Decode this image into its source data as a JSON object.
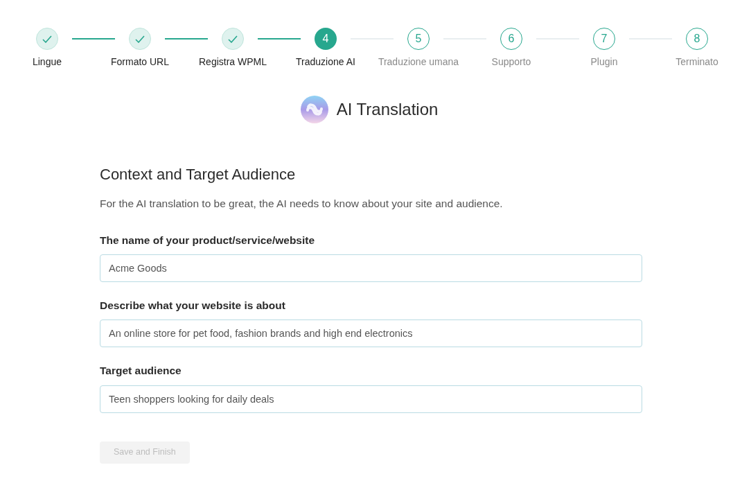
{
  "steps": [
    {
      "label": "Lingue",
      "completed": true,
      "selected": false
    },
    {
      "label": "Formato URL",
      "completed": true,
      "selected": false
    },
    {
      "label": "Registra WPML",
      "completed": true,
      "selected": false
    },
    {
      "number": "4",
      "label": "Traduzione AI",
      "completed": false,
      "selected": true
    },
    {
      "number": "5",
      "label": "Traduzione umana",
      "completed": false,
      "selected": false
    },
    {
      "number": "6",
      "label": "Supporto",
      "completed": false,
      "selected": false
    },
    {
      "number": "7",
      "label": "Plugin",
      "completed": false,
      "selected": false
    },
    {
      "number": "8",
      "label": "Terminato",
      "completed": false,
      "selected": false
    }
  ],
  "header": {
    "title": "AI Translation"
  },
  "section": {
    "title": "Context and Target Audience",
    "description": "For the AI translation to be great, the AI needs to know about your site and audience."
  },
  "fields": [
    {
      "label": "The name of your product/service/website",
      "value": "Acme Goods"
    },
    {
      "label": "Describe what your website is about",
      "value": "An online store for pet food, fashion brands and high end electronics"
    },
    {
      "label": "Target audience",
      "value": "Teen shoppers looking for daily deals"
    }
  ],
  "submit": {
    "label": "Save and Finish",
    "disabled": true
  }
}
